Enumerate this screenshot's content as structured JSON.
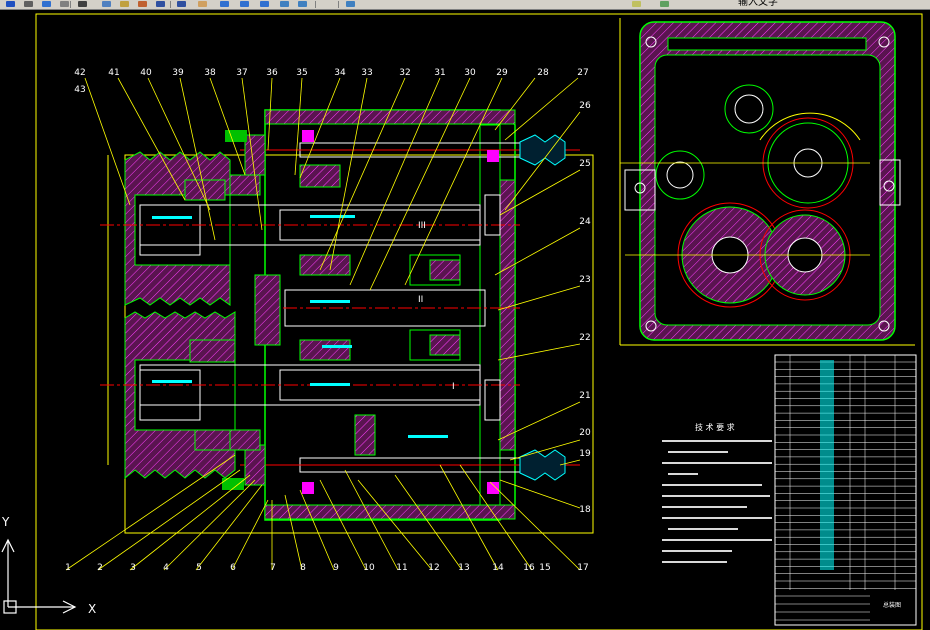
{
  "toolbar": {
    "buttons": [
      {
        "icon": "save-icon",
        "color": "#2050c0"
      },
      {
        "icon": "print-icon",
        "color": "#606060"
      },
      {
        "icon": "preview-icon",
        "color": "#3070d0"
      },
      {
        "icon": "publish-icon",
        "color": "#808080"
      },
      {
        "icon": "cut-icon",
        "color": "#404040"
      },
      {
        "icon": "copy-icon",
        "color": "#5080c0"
      },
      {
        "icon": "paste-icon",
        "color": "#c0a040"
      },
      {
        "icon": "match-properties-icon",
        "color": "#c06030"
      },
      {
        "icon": "undo-icon",
        "color": "#3050a0"
      },
      {
        "icon": "redo-icon",
        "color": "#3050a0"
      },
      {
        "icon": "pan-icon",
        "color": "#d0a060"
      },
      {
        "icon": "zoom-realtime-icon",
        "color": "#3070d0"
      },
      {
        "icon": "zoom-window-icon",
        "color": "#3070d0"
      },
      {
        "icon": "zoom-previous-icon",
        "color": "#3070d0"
      },
      {
        "icon": "properties-icon",
        "color": "#4080c0"
      },
      {
        "icon": "design-center-icon",
        "color": "#4080c0"
      },
      {
        "icon": "tool-palettes-icon",
        "color": "#4080c0"
      },
      {
        "icon": "layer-icon",
        "color": "#c0c060"
      },
      {
        "icon": "layer-state-icon",
        "color": "#60a060"
      }
    ],
    "label": "输入文字"
  },
  "colors": {
    "background": "#000000",
    "frame": "#ffff00",
    "outline": "#00ff00",
    "center_line": "#ff0000",
    "hatch": "#ff00ff",
    "text": "#ffffff",
    "dimension": "#00ffff"
  },
  "drawing": {
    "part_numbers_top": [
      "42",
      "43",
      "41",
      "40",
      "39",
      "38",
      "37",
      "36",
      "35",
      "34",
      "33",
      "32",
      "31",
      "30",
      "29",
      "28",
      "27"
    ],
    "part_numbers_right": [
      "26",
      "25",
      "24",
      "23",
      "22",
      "21",
      "20",
      "19",
      "18"
    ],
    "part_numbers_bottom": [
      "1",
      "2",
      "3",
      "4",
      "5",
      "6",
      "7",
      "8",
      "9",
      "10",
      "11",
      "12",
      "13",
      "14",
      "16",
      "15",
      "17"
    ],
    "shaft_labels": [
      "III",
      "II",
      "I"
    ],
    "tech_requirements_title": "技 术 要 求",
    "title_block_name": "总装图"
  },
  "ucs": {
    "x_label": "X",
    "y_label": "Y"
  }
}
